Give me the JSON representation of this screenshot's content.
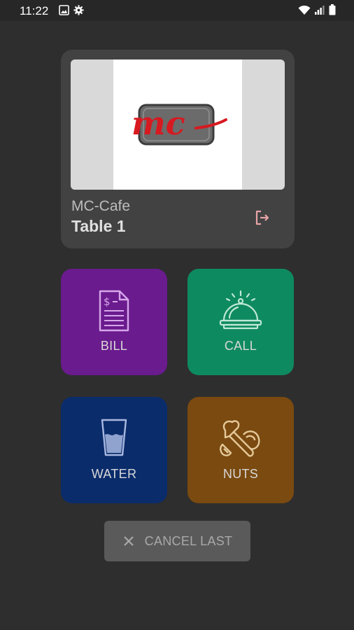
{
  "status_bar": {
    "time": "11:22",
    "left_icons": [
      "gallery-icon",
      "gear-icon"
    ],
    "right_icons": [
      "wifi-icon",
      "signal-icon",
      "battery-icon"
    ]
  },
  "venue_card": {
    "logo_text": "mc",
    "cafe_name": "MC-Cafe",
    "table_name": "Table 1",
    "exit_icon": "logout-icon"
  },
  "actions": [
    {
      "label": "BILL",
      "icon": "bill-icon",
      "color": "#6a1b8e"
    },
    {
      "label": "CALL",
      "icon": "service-bell-icon",
      "color": "#0e8a60"
    },
    {
      "label": "WATER",
      "icon": "water-glass-icon",
      "color": "#0b2c6b"
    },
    {
      "label": "NUTS",
      "icon": "nuts-icon",
      "color": "#7a4a10"
    }
  ],
  "cancel": {
    "label": "CANCEL LAST",
    "icon": "close-icon"
  },
  "colors": {
    "background": "#2e2e2e",
    "card": "#424242",
    "brand_red": "#d71920"
  }
}
